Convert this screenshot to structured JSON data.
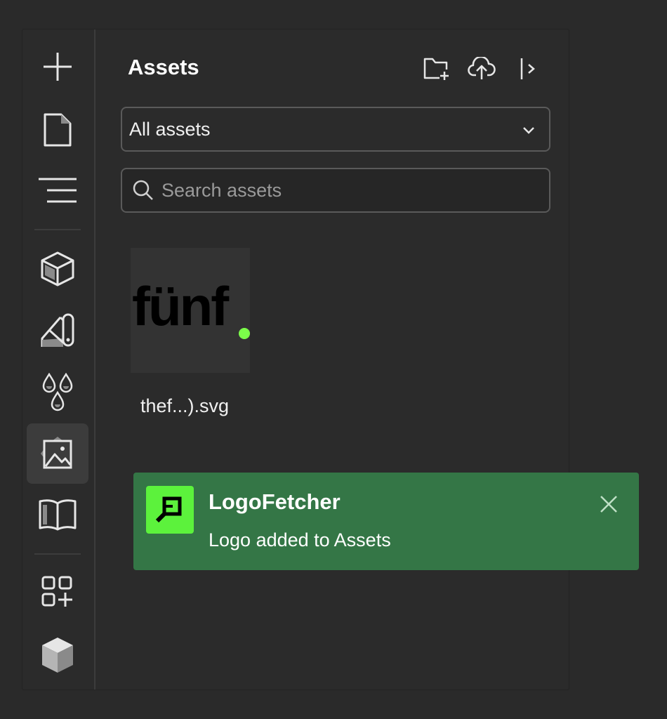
{
  "sidebar": {
    "icons": [
      "plus-icon",
      "page-icon",
      "navigator-icon",
      "components-icon",
      "style-manager-icon",
      "variables-icon",
      "assets-icon",
      "cms-icon",
      "apps-icon",
      "3d-box-icon"
    ],
    "active": "assets-icon"
  },
  "panel": {
    "title": "Assets",
    "header_icons": [
      "new-folder-icon",
      "upload-icon",
      "collapse-panel-icon"
    ],
    "filter": {
      "selected": "All assets"
    },
    "search": {
      "placeholder": "Search assets",
      "value": ""
    }
  },
  "assets": [
    {
      "name": "thef...).svg",
      "logo_text": "fünf",
      "dot_color": "#7cff4a"
    }
  ],
  "toast": {
    "app_name": "LogoFetcher",
    "message": "Logo added to Assets",
    "background": "#347646",
    "logo_background": "#5cf23c"
  },
  "colors": {
    "page_background": "#2a2a2a",
    "panel_background": "#2b2b2b",
    "border": "#3c3c3c",
    "text": "#f0f0f0"
  }
}
